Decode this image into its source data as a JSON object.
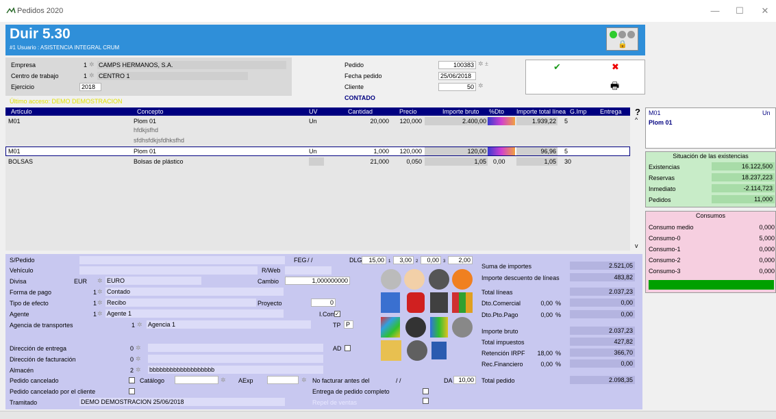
{
  "window": {
    "title": "Pedidos 2020"
  },
  "header": {
    "version": "Duir 5.30",
    "user": "#1 Usuario : ASISTENCIA INTEGRAL CRUM"
  },
  "top": {
    "empresa_label": "Empresa",
    "empresa_code": "1",
    "empresa_name": "CAMPS HERMANOS, S.A.",
    "centro_label": "Centro de trabajo",
    "centro_code": "1",
    "centro_name": "CENTRO 1",
    "ejercicio_label": "Ejercicio",
    "ejercicio_value": "2018",
    "ultimo_acceso": "Último acceso: DEMO DEMOSTRACION",
    "pedido_label": "Pedido",
    "pedido_value": "100383",
    "fecha_label": "Fecha pedido",
    "fecha_value": "25/06/2018",
    "cliente_label": "Cliente",
    "cliente_value": "50",
    "contado": "CONTADO"
  },
  "buttons": {
    "accept": "✔",
    "cancel": "✖",
    "print": "🖶",
    "help": "?"
  },
  "table": {
    "headers": [
      "Artículo",
      "Concepto",
      "UV",
      "Cantidad",
      "Precio",
      "Importe bruto",
      "%Dto",
      "Importe total línea",
      "G.Imp",
      "Entrega"
    ],
    "rows": [
      {
        "articulo": "M01",
        "concepto": "Plom 01",
        "uv": "Un",
        "cantidad": "20,000",
        "precio": "120,000",
        "bruto": "2.400,00",
        "dto": "",
        "total": "1.939,22",
        "gimp": "5",
        "extra1": "hfdkjsfhd",
        "extra2": "sfdhsfdkjsfdhksfhd"
      },
      {
        "articulo": "M01",
        "concepto": "Plom 01",
        "uv": "Un",
        "cantidad": "1,000",
        "precio": "120,000",
        "bruto": "120,00",
        "dto": "",
        "total": "96,96",
        "gimp": "5"
      },
      {
        "articulo": "BOLSAS",
        "concepto": "Bolsas de plástico",
        "uv": "",
        "cantidad": "21,000",
        "precio": "0,050",
        "bruto": "1,05",
        "dto": "0,00",
        "total": "1,05",
        "gimp": "30"
      }
    ]
  },
  "bottom": {
    "spedido": "S/Pedido",
    "vehiculo": "Vehículo",
    "rweb": "R/Web",
    "feg": "FEG",
    "feg_val": "/ /",
    "dlg": "DLG",
    "dlg1": "15,00",
    "dlg2": "3,00",
    "dlg3": "0,00",
    "dlg4": "2,00",
    "dlg_n1": "1",
    "dlg_n2": "2",
    "dlg_n3": "3",
    "divisa": "Divisa",
    "divisa_code": "EUR",
    "divisa_name": "EURO",
    "cambio": "Cambio",
    "cambio_val": "1,000000000",
    "forma": "Forma de pago",
    "forma_code": "1",
    "forma_name": "Contado",
    "tipo": "Tipo de efecto",
    "tipo_code": "1",
    "tipo_name": "Recibo",
    "proyecto": "Proyecto",
    "proyecto_val": "0",
    "agente": "Agente",
    "agente_code": "1",
    "agente_name": "Agente 1",
    "icom": "I.Com",
    "agencia": "Agencia de transportes",
    "agencia_code": "1",
    "agencia_name": "Agencia 1",
    "tp": "TP",
    "tp_val": "P",
    "dir_entrega": "Dirección de entrega",
    "dir_entrega_val": "0",
    "ad": "AD",
    "dir_fact": "Dirección de facturación",
    "dir_fact_val": "0",
    "almacen": "Almacén",
    "almacen_code": "2",
    "almacen_name": "bbbbbbbbbbbbbbbbbbb",
    "cancelado": "Pedido cancelado",
    "catalogo": "Catálogo",
    "aexp": "AExp",
    "no_facturar": "No facturar antes del",
    "no_facturar_val": "/ /",
    "da": "DA",
    "da_val": "10,00",
    "cancelado_cliente": "Pedido cancelado por el cliente",
    "entrega_completo": "Entrega de pedido completo",
    "tramitado": "Tramitado",
    "tramitado_val": "DEMO DEMOSTRACION 25/06/2018",
    "repel": "Repel de ventas"
  },
  "totals": {
    "suma": "Suma de importes",
    "suma_val": "2.521,05",
    "desc": "Importe descuento de líneas",
    "desc_val": "483,82",
    "total_lineas": "Total líneas",
    "total_lineas_val": "2.037,23",
    "dto_com": "Dto.Comercial",
    "dto_com_pct": "0,00",
    "dto_com_val": "0,00",
    "dto_pp": "Dto.Pto.Pago",
    "dto_pp_pct": "0,00",
    "dto_pp_val": "0,00",
    "bruto": "Importe bruto",
    "bruto_val": "2.037,23",
    "impuestos": "Total impuestos",
    "impuestos_val": "427,82",
    "irpf": "Retención IRPF",
    "irpf_pct": "18,00",
    "irpf_val": "366,70",
    "recfin": "Rec.Financiero",
    "recfin_pct": "0,00",
    "recfin_val": "0,00",
    "total": "Total pedido",
    "total_val": "2.098,35",
    "pct": "%"
  },
  "side": {
    "art": "M01",
    "unit": "Un",
    "name": "Plom 01",
    "exist_title": "Situación de las existencias",
    "existencias": "Existencias",
    "existencias_val": "16.122,500",
    "reservas": "Reservas",
    "reservas_val": "18.237,223",
    "inmediato": "Inmediato",
    "inmediato_val": "-2.114,723",
    "pedidos": "Pedidos",
    "pedidos_val": "11,000",
    "cons_title": "Consumos",
    "medio": "Consumo medio",
    "medio_val": "0,000",
    "c0": "Consumo-0",
    "c0_val": "5,000",
    "c1": "Consumo-1",
    "c1_val": "0,000",
    "c2": "Consumo-2",
    "c2_val": "0,000",
    "c3": "Consumo-3",
    "c3_val": "0,000"
  },
  "colors": {
    "header": "#2f8fd9",
    "table_head": "#000080",
    "bottom": "#c8c8f0",
    "green": "#c8ecc8",
    "pink": "#f6cfe0"
  }
}
